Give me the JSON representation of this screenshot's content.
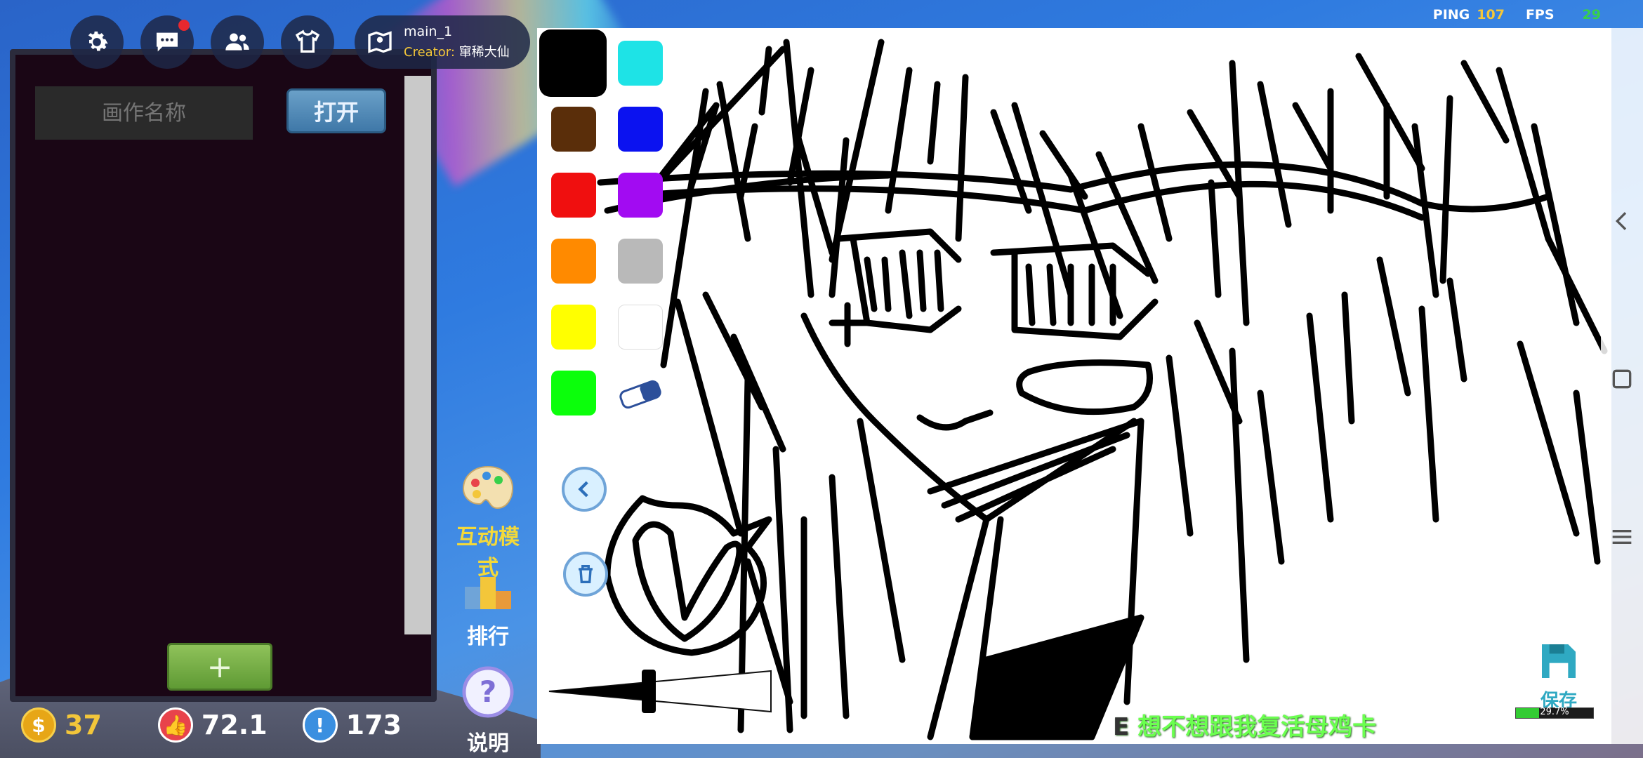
{
  "stats": {
    "ping_label": "PING",
    "ping_value": "107",
    "fps_label": "FPS",
    "fps_value": "29"
  },
  "top_bar": {
    "map_name": "main_1",
    "creator_label": "Creator:",
    "creator_name": "窜稀大仙"
  },
  "left_panel": {
    "name_placeholder": "画作名称",
    "open_label": "打开",
    "add_label": "+"
  },
  "currency": {
    "coins": "37",
    "likes": "72.1",
    "alerts": "173"
  },
  "palette": {
    "colors": [
      "#000000",
      "#1ee3e6",
      "#5a2e0a",
      "#0b12f0",
      "#f00f0f",
      "#a20bf2",
      "#ff8a00",
      "#b9b9b9",
      "#ffff00",
      "#ffffff",
      "#0bff0b"
    ]
  },
  "modes": {
    "interactive_label": "互动模式",
    "rank_label": "排行",
    "help_label": "说明"
  },
  "save": {
    "label": "保存",
    "progress_text": "29.7%",
    "progress": 0.297
  },
  "ticker": {
    "prefix": "E",
    "text": "想不想跟我复活母鸡卡"
  }
}
